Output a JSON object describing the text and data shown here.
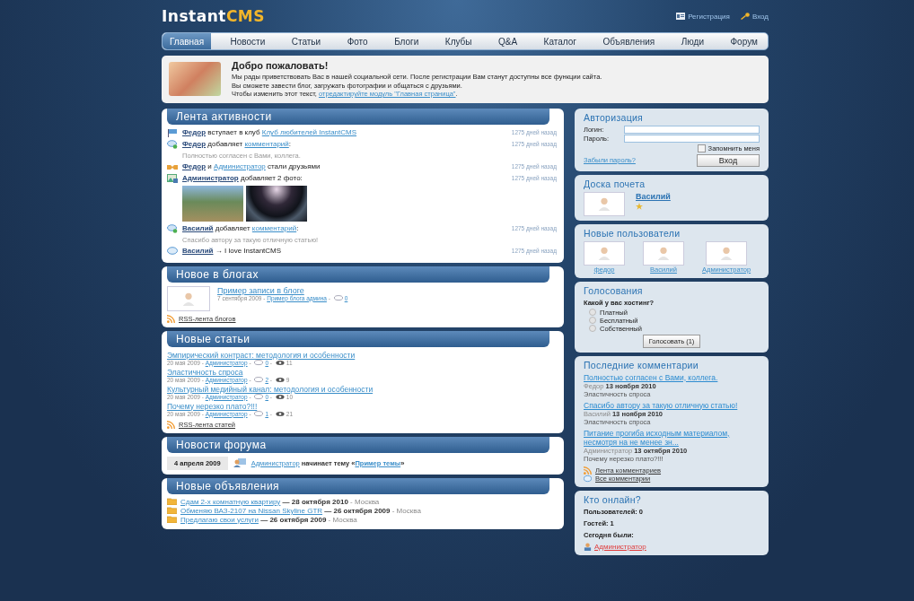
{
  "header": {
    "logo": {
      "part1": "Instant",
      "part2": "CMS"
    },
    "links": [
      {
        "kind": "register",
        "label": "Регистрация"
      },
      {
        "kind": "login",
        "label": "Вход"
      }
    ]
  },
  "nav": [
    {
      "label": "Главная",
      "selected": true
    },
    {
      "label": "Новости",
      "selected": false
    },
    {
      "label": "Статьи",
      "selected": false
    },
    {
      "label": "Фото",
      "selected": false
    },
    {
      "label": "Блоги",
      "selected": false
    },
    {
      "label": "Клубы",
      "selected": false
    },
    {
      "label": "Q&A",
      "selected": false
    },
    {
      "label": "Каталог",
      "selected": false
    },
    {
      "label": "Объявления",
      "selected": false
    },
    {
      "label": "Люди",
      "selected": false
    },
    {
      "label": "Форум",
      "selected": false
    }
  ],
  "welcome": {
    "title": "Добро пожаловать!",
    "lines": [
      [
        {
          "kind": "plain",
          "text": "Мы рады приветствовать Вас в нашей социальной сети. После регистрации Вам станут доступны все функции сайта."
        }
      ],
      [
        {
          "kind": "plain",
          "text": "Вы сможете завести блог, загружать фотографии и общаться с друзьями."
        }
      ],
      [
        {
          "kind": "plain",
          "text": "Чтобы изменить этот текст, "
        },
        {
          "kind": "link",
          "text": "отредактируйте модуль \"Главная страница\""
        },
        {
          "kind": "plain",
          "text": "."
        }
      ]
    ]
  },
  "activity": {
    "title": "Лента активности",
    "items": [
      {
        "kind": "flag",
        "parts": [
          {
            "kind": "user",
            "text": "Федор"
          },
          {
            "kind": "plain",
            "text": " вступает в клуб "
          },
          {
            "kind": "link",
            "text": "Клуб любителей InstantCMS"
          }
        ],
        "time": "1275 дней назад"
      },
      {
        "kind": "comment",
        "parts": [
          {
            "kind": "user",
            "text": "Федор"
          },
          {
            "kind": "plain",
            "text": " добавляет "
          },
          {
            "kind": "link",
            "text": "комментарий"
          },
          {
            "kind": "plain",
            "text": ":"
          }
        ],
        "quote": "Полностью согласен с Вами, коллега.",
        "time": "1275 дней назад"
      },
      {
        "kind": "friends",
        "parts": [
          {
            "kind": "user",
            "text": "Федор"
          },
          {
            "kind": "plain",
            "text": " и "
          },
          {
            "kind": "link",
            "text": "Администратор"
          },
          {
            "kind": "plain",
            "text": " стали друзьями"
          }
        ],
        "time": "1275 дней назад"
      },
      {
        "kind": "photo",
        "parts": [
          {
            "kind": "user",
            "text": "Администратор"
          },
          {
            "kind": "plain",
            "text": " добавляет 2 фото:"
          }
        ],
        "photos": [
          {
            "kind": "mountains"
          },
          {
            "kind": "horizon"
          }
        ],
        "time": "1275 дней назад"
      },
      {
        "kind": "comment",
        "parts": [
          {
            "kind": "user",
            "text": "Василий"
          },
          {
            "kind": "plain",
            "text": " добавляет "
          },
          {
            "kind": "link",
            "text": "комментарий"
          },
          {
            "kind": "plain",
            "text": ":"
          }
        ],
        "quote": "Спасибо автору за такую отличную статью!",
        "time": "1275 дней назад"
      },
      {
        "kind": "status",
        "parts": [
          {
            "kind": "user",
            "text": "Василий"
          },
          {
            "kind": "plain",
            "text": " → I love InstantCMS"
          }
        ],
        "time": "1275 дней назад"
      }
    ]
  },
  "blogs": {
    "title": "Новое в блогах",
    "post": {
      "title": "Пример записи в блоге",
      "meta": [
        {
          "kind": "muted",
          "text": "7 сентября 2009 - "
        },
        {
          "kind": "link",
          "text": "Пример блога админа"
        },
        {
          "kind": "muted",
          "text": " - "
        },
        {
          "kind": "comments",
          "text": "0"
        }
      ]
    },
    "rss": "RSS-лента блогов"
  },
  "articles": {
    "title": "Новые статьи",
    "items": [
      {
        "title": "Эмпирический контраст: методология и особенности",
        "meta": [
          {
            "kind": "muted",
            "text": "20 мая 2009 - "
          },
          {
            "kind": "link",
            "text": "Администратор"
          },
          {
            "kind": "muted",
            "text": " - "
          },
          {
            "kind": "comments",
            "text": "0"
          },
          {
            "kind": "muted",
            "text": " - "
          },
          {
            "kind": "views",
            "text": "11"
          }
        ]
      },
      {
        "title": "Эластичность спроса",
        "meta": [
          {
            "kind": "muted",
            "text": "20 мая 2009 - "
          },
          {
            "kind": "link",
            "text": "Администратор"
          },
          {
            "kind": "muted",
            "text": " - "
          },
          {
            "kind": "comments",
            "text": "2"
          },
          {
            "kind": "muted",
            "text": " - "
          },
          {
            "kind": "views",
            "text": "9"
          }
        ]
      },
      {
        "title": "Культурный медийный канал: методология и особенности",
        "meta": [
          {
            "kind": "muted",
            "text": "20 мая 2009 - "
          },
          {
            "kind": "link",
            "text": "Администратор"
          },
          {
            "kind": "muted",
            "text": " - "
          },
          {
            "kind": "comments",
            "text": "0"
          },
          {
            "kind": "muted",
            "text": " - "
          },
          {
            "kind": "views",
            "text": "10"
          }
        ]
      },
      {
        "title": "Почему нерезко плато?!!!",
        "meta": [
          {
            "kind": "muted",
            "text": "20 мая 2009 - "
          },
          {
            "kind": "link",
            "text": "Администратор"
          },
          {
            "kind": "muted",
            "text": " - "
          },
          {
            "kind": "comments",
            "text": "1"
          },
          {
            "kind": "muted",
            "text": " - "
          },
          {
            "kind": "views",
            "text": "21"
          }
        ]
      }
    ],
    "rss": "RSS-лента статей"
  },
  "forum": {
    "title": "Новости форума",
    "date": "4 апреля 2009",
    "parts": [
      {
        "kind": "link",
        "text": "Администратор"
      },
      {
        "kind": "bold",
        "text": " начинает тему «"
      },
      {
        "kind": "boldlink",
        "text": "Пример темы"
      },
      {
        "kind": "bold",
        "text": "»"
      }
    ]
  },
  "ads": {
    "title": "Новые объявления",
    "items": [
      [
        {
          "kind": "link",
          "text": "Сдам 2-х комнатную квартиру"
        },
        {
          "kind": "bold",
          "text": " — 28 октября 2010"
        },
        {
          "kind": "muted",
          "text": " - Москва"
        }
      ],
      [
        {
          "kind": "link",
          "text": "Обменяю ВАЗ-2107 на Nissan Skyline GTR"
        },
        {
          "kind": "bold",
          "text": " — 26 октября 2009"
        },
        {
          "kind": "muted",
          "text": " - Москва"
        }
      ],
      [
        {
          "kind": "link",
          "text": "Предлагаю свои услуги"
        },
        {
          "kind": "bold",
          "text": " — 26 октября 2009"
        },
        {
          "kind": "muted",
          "text": " - Москва"
        }
      ]
    ]
  },
  "auth": {
    "title": "Авторизация",
    "login_label": "Логин:",
    "password_label": "Пароль:",
    "remember": {
      "label": "Запомнить меня",
      "checked": false
    },
    "forgot": "Забыли пароль?",
    "button": "Вход"
  },
  "honor": {
    "title": "Доска почета",
    "user": "Василий"
  },
  "new_users": {
    "title": "Новые пользователи",
    "users": [
      "федор",
      "Василий",
      "Администратор"
    ]
  },
  "poll": {
    "title": "Голосования",
    "question": "Какой у вас хостинг?",
    "options": [
      {
        "label": "Платный",
        "selected": false
      },
      {
        "label": "Бесплатный",
        "selected": false
      },
      {
        "label": "Собственный",
        "selected": false
      }
    ],
    "button": "Голосовать (1)"
  },
  "comments": {
    "title": "Последние комментарии",
    "items": [
      {
        "text": "Полностью согласен с Вами, коллега.",
        "meta": [
          {
            "kind": "muted",
            "text": "Федор "
          },
          {
            "kind": "bold",
            "text": "13 ноября 2010"
          }
        ],
        "target": "Эластичность спроса"
      },
      {
        "text": "Спасибо автору за такую отличную статью!",
        "meta": [
          {
            "kind": "muted",
            "text": "Василий "
          },
          {
            "kind": "bold",
            "text": "13 ноября 2010"
          }
        ],
        "target": "Эластичность спроса"
      },
      {
        "text": "Питание прогиба исходным материалом, несмотря на не менее зн...",
        "meta": [
          {
            "kind": "muted",
            "text": "Администратор "
          },
          {
            "kind": "bold",
            "text": "13 октября 2010"
          }
        ],
        "target": "Почему нерезко плато?!!!"
      }
    ],
    "links": [
      {
        "kind": "rss",
        "label": "Лента комментариев"
      },
      {
        "kind": "comment",
        "label": "Все комментарии"
      }
    ]
  },
  "online": {
    "title": "Кто онлайн?",
    "lines": [
      "Пользователей: 0",
      "Гостей: 1",
      "Сегодня были:"
    ],
    "today_users": [
      "Администратор"
    ]
  }
}
